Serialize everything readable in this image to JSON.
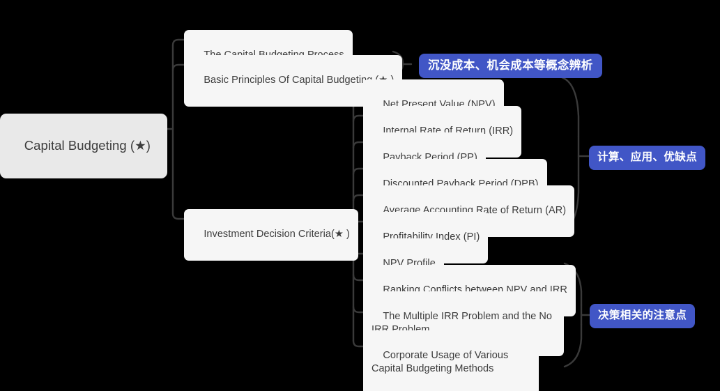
{
  "mindmap": {
    "root": {
      "label": "Capital Budgeting (★)"
    },
    "level2": [
      {
        "label": "The Capital Budgeting Process"
      },
      {
        "label": "Basic Principles Of Capital Budgeting (★ )"
      },
      {
        "label": "Investment Decision Criteria(★ )"
      }
    ],
    "level3": [
      {
        "label": "Net Present Value (NPV)"
      },
      {
        "label": "Internal Rate of Return (IRR)"
      },
      {
        "label": "Payback Period (PP)"
      },
      {
        "label": "Discounted Payback Period (DPB)"
      },
      {
        "label": "Average Accounting Rate of Return (AR)"
      },
      {
        "label": "Profitability Index (PI)"
      },
      {
        "label": "NPV Profile"
      },
      {
        "label": "Ranking Conflicts between NPV and IRR"
      },
      {
        "label": "The Multiple IRR Problem and the No IRR Problem"
      },
      {
        "label": "Corporate Usage of Various Capital Budgeting Methods"
      }
    ],
    "annotations": [
      {
        "label": "沉没成本、机会成本等概念辨析"
      },
      {
        "label": "计算、应用、优缺点"
      },
      {
        "label": "决策相关的注意点"
      }
    ],
    "colors": {
      "background": "#000000",
      "node_fill": "#f6f6f6",
      "root_fill": "#e9e9e9",
      "node_text": "#3c3c3c",
      "badge_fill": "#4156c6",
      "badge_text": "#ffffff",
      "connector": "#3a3a3a"
    }
  }
}
